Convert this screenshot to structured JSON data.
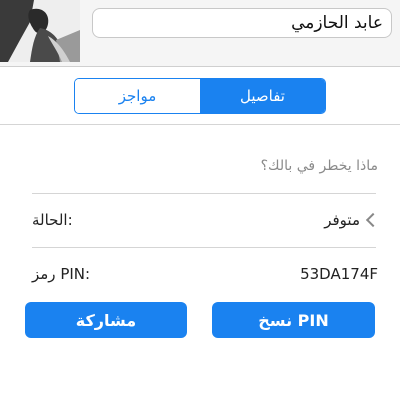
{
  "profile": {
    "name": "عابد الحازمي",
    "avatar_icon": "profile-photo"
  },
  "tabs": [
    {
      "label": "تفاصيل",
      "selected": true
    },
    {
      "label": "مواجز",
      "selected": false
    }
  ],
  "status_message_placeholder": "ماذا يخطر في بالك؟",
  "status": {
    "label": "الحالة:",
    "value": "متوفر"
  },
  "pin": {
    "label": "رمز PIN:",
    "value": "53DA174F"
  },
  "buttons": {
    "share": "مشاركة",
    "copy_pin": "نسخ PIN"
  },
  "colors": {
    "accent": "#1a82f0"
  }
}
